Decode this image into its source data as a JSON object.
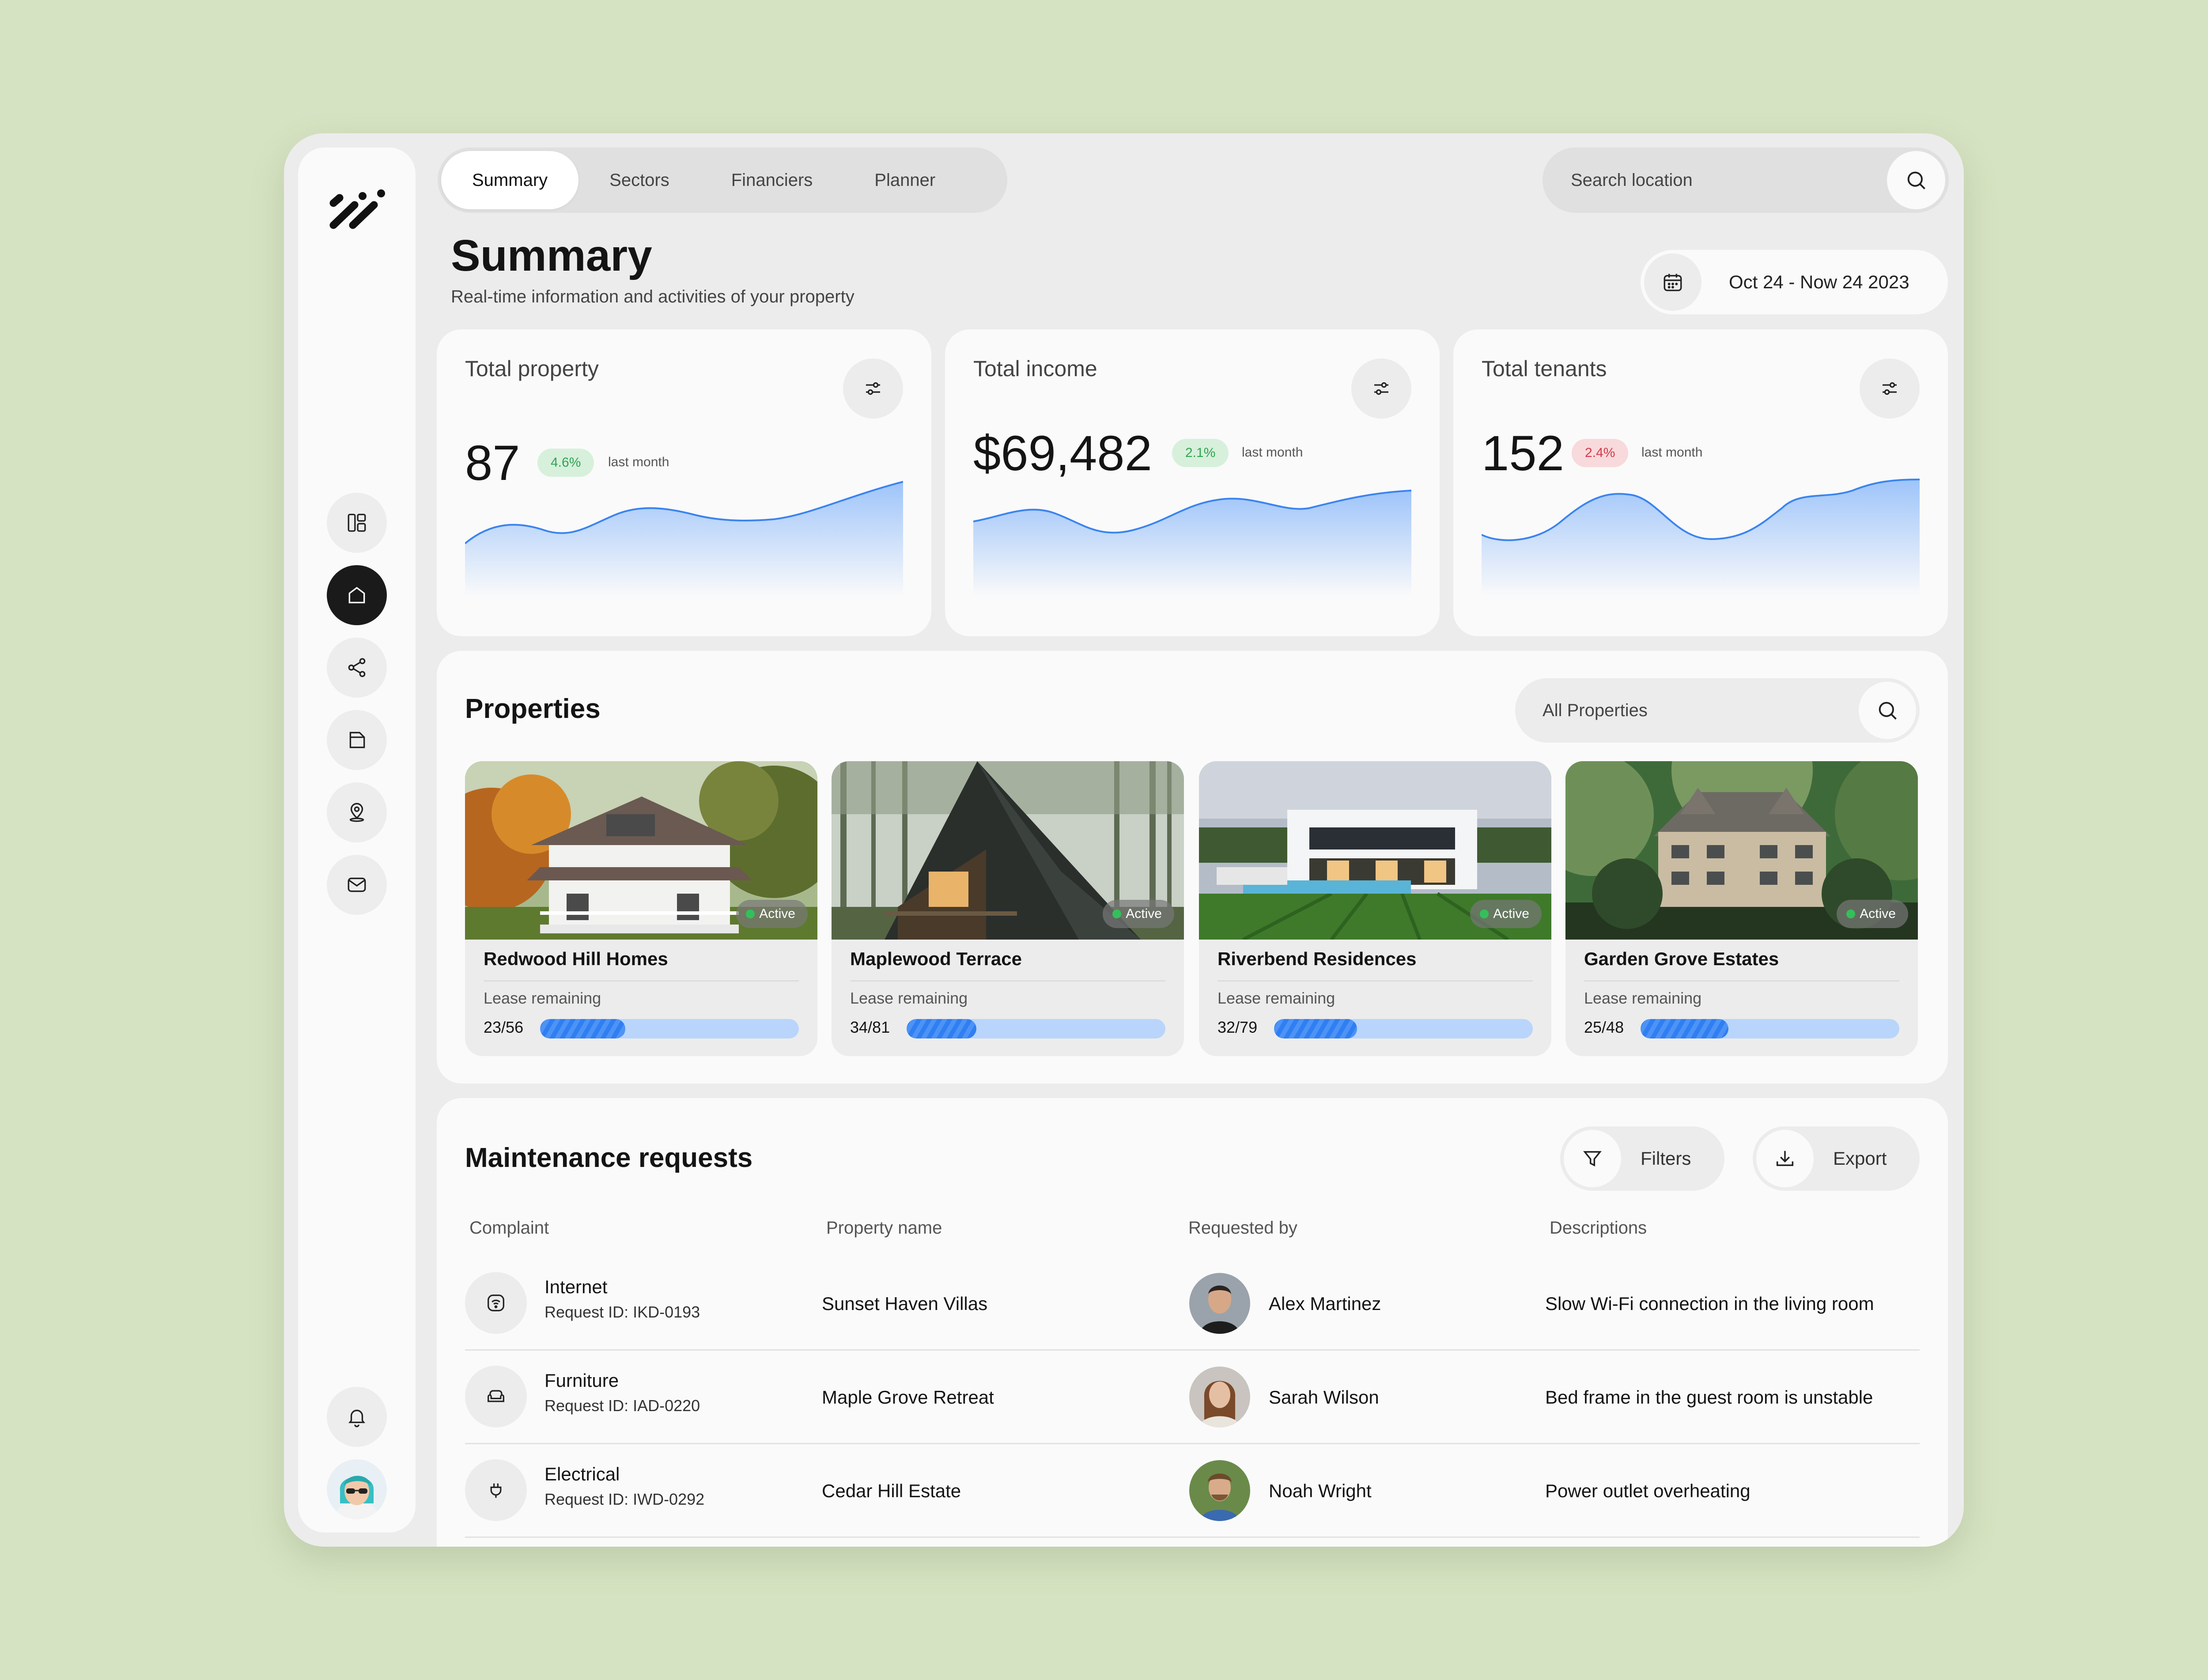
{
  "tabs": [
    "Summary",
    "Sectors",
    "Financiers",
    "Planner"
  ],
  "search": {
    "placeholder": "Search location"
  },
  "page": {
    "title": "Summary",
    "subtitle": "Real-time information and activities of your property"
  },
  "date_range": "Oct 24 - Now 24 2023",
  "sidebar_icons": [
    "layout-icon",
    "home-icon",
    "share-icon",
    "wallet-icon",
    "location-icon",
    "mail-icon",
    "bell-icon"
  ],
  "stats": [
    {
      "title": "Total property",
      "value": "87",
      "change": "4.6%",
      "trend": "up",
      "period": "last month"
    },
    {
      "title": "Total income",
      "value": "$69,482",
      "change": "2.1%",
      "trend": "up",
      "period": "last month"
    },
    {
      "title": "Total tenants",
      "value": "152",
      "change": "2.4%",
      "trend": "down",
      "period": "last month"
    }
  ],
  "properties": {
    "title": "Properties",
    "filter": "All Properties",
    "items": [
      {
        "name": "Redwood Hill Homes",
        "status": "Active",
        "lease_label": "Lease remaining",
        "lease": "23/56",
        "progress": 0.33
      },
      {
        "name": "Maplewood Terrace",
        "status": "Active",
        "lease_label": "Lease remaining",
        "lease": "34/81",
        "progress": 0.27
      },
      {
        "name": "Riverbend Residences",
        "status": "Active",
        "lease_label": "Lease remaining",
        "lease": "32/79",
        "progress": 0.32
      },
      {
        "name": "Garden Grove Estates",
        "status": "Active",
        "lease_label": "Lease remaining",
        "lease": "25/48",
        "progress": 0.34
      }
    ]
  },
  "maintenance": {
    "title": "Maintenance requests",
    "filters_label": "Filters",
    "export_label": "Export",
    "columns": [
      "Complaint",
      "Property name",
      "Requested by",
      "Descriptions"
    ],
    "rows": [
      {
        "complaint": "Internet",
        "request_id": "Request ID: IKD-0193",
        "property": "Sunset Haven Villas",
        "requested_by": "Alex Martinez",
        "description": "Slow Wi-Fi connection in the living room"
      },
      {
        "complaint": "Furniture",
        "request_id": "Request ID: IAD-0220",
        "property": "Maple Grove Retreat",
        "requested_by": "Sarah Wilson",
        "description": "Bed frame in the guest room is unstable"
      },
      {
        "complaint": "Electrical",
        "request_id": "Request ID: IWD-0292",
        "property": "Cedar Hill Estate",
        "requested_by": "Noah Wright",
        "description": "Power outlet overheating"
      }
    ]
  },
  "colors": {
    "accent": "#2f7ff2",
    "up": "#2ea44f",
    "down": "#d33a4a",
    "background": "#d6e3c2"
  }
}
